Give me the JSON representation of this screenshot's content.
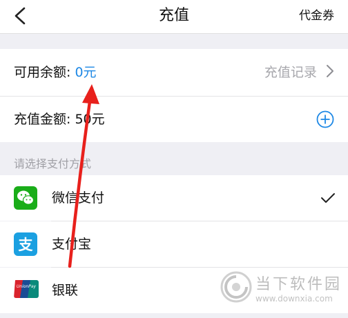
{
  "nav": {
    "title": "充值",
    "right_label": "代金券"
  },
  "balance": {
    "label": "可用余额: ",
    "value": "0元",
    "record_link": "充值记录"
  },
  "recharge": {
    "label": "充值金额: 50元"
  },
  "payment": {
    "section_label": "请选择支付方式",
    "methods": [
      {
        "name": "微信支付",
        "icon": "wechat-pay-icon",
        "selected": true
      },
      {
        "name": "支付宝",
        "icon": "alipay-icon",
        "selected": false
      },
      {
        "name": "银联",
        "icon": "unionpay-icon",
        "selected": false
      }
    ]
  },
  "watermark": {
    "name": "当下软件园",
    "url": "www.downxia.com"
  },
  "colors": {
    "accent_blue": "#1e88e5",
    "wechat_green": "#1aad19",
    "alipay_blue": "#1ba0e1",
    "arrow_red": "#e8201c"
  }
}
